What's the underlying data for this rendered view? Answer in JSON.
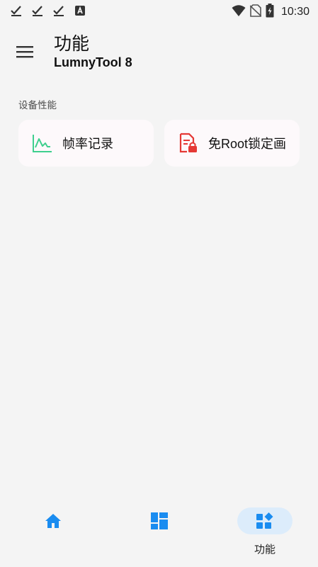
{
  "status_bar": {
    "time": "10:30",
    "left_icons": [
      "check-download-icon",
      "check-download-icon",
      "check-download-icon",
      "app-notification-icon"
    ],
    "right_icons": [
      "wifi-icon",
      "no-sim-icon",
      "battery-charging-icon"
    ]
  },
  "header": {
    "title": "功能",
    "subtitle": "LumnyTool 8",
    "menu_icon": "hamburger-menu-icon"
  },
  "section": {
    "label": "设备性能"
  },
  "cards": [
    {
      "label": "帧率记录",
      "icon": "line-chart-icon",
      "icon_color": "#3fcf8e"
    },
    {
      "label": "免Root锁定画",
      "icon": "document-lock-icon",
      "icon_color": "#e53935"
    }
  ],
  "bottom_nav": {
    "items": [
      {
        "label": "",
        "icon": "home-icon",
        "active": false
      },
      {
        "label": "",
        "icon": "grid-icon",
        "active": false
      },
      {
        "label": "功能",
        "icon": "widgets-icon",
        "active": true
      }
    ],
    "accent_color": "#1a8cf0",
    "active_pill_color": "#dcecfb"
  }
}
